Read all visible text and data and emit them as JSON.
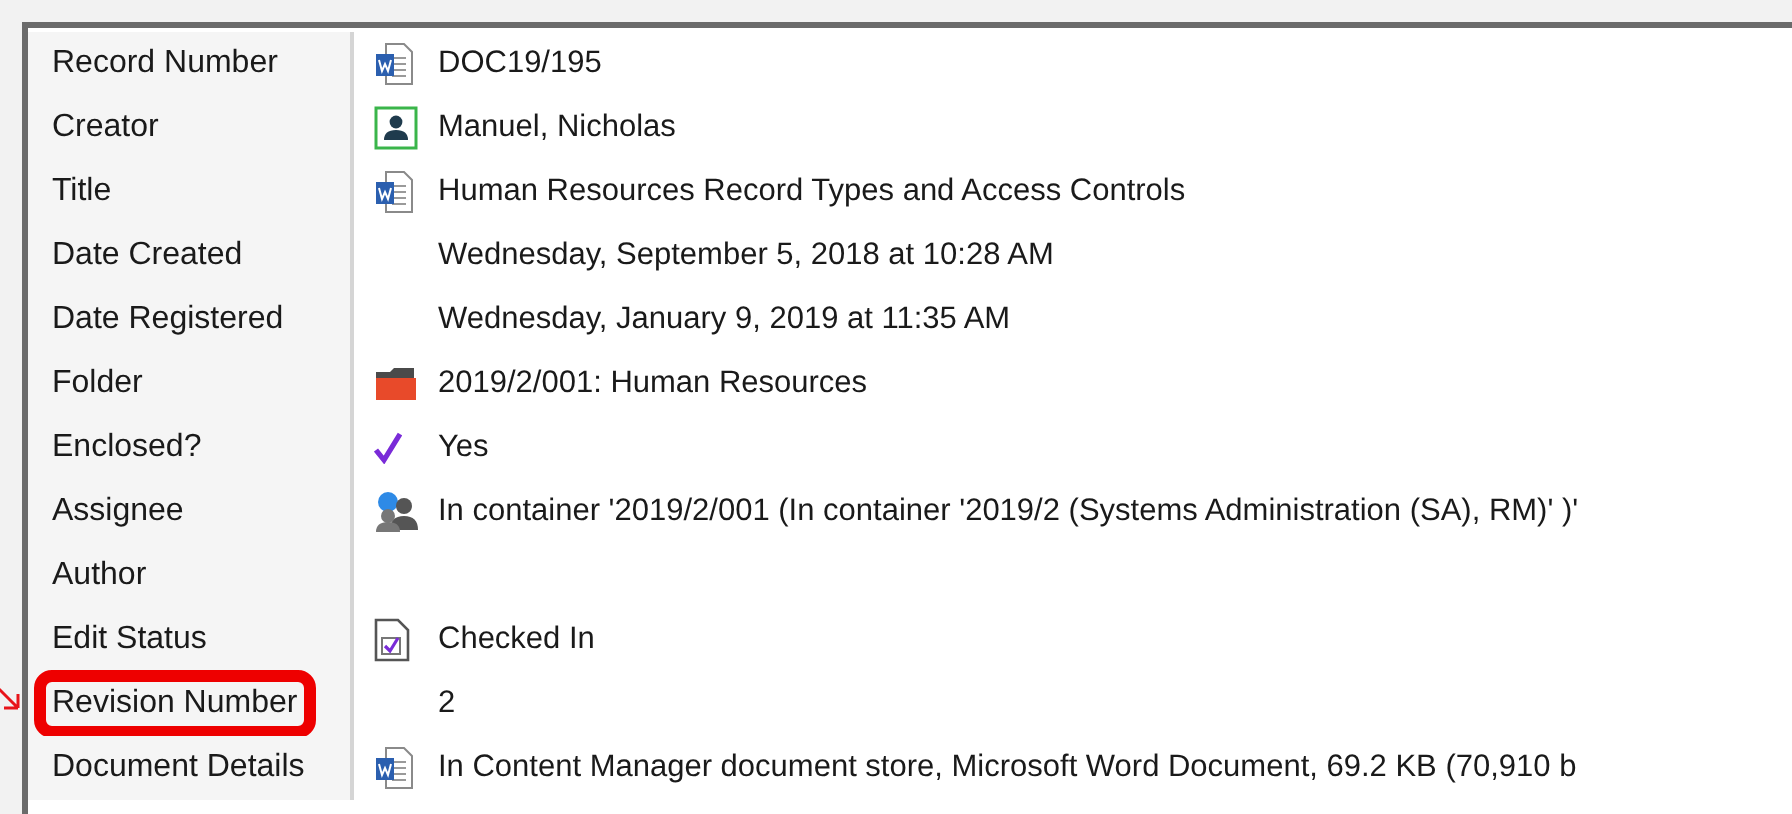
{
  "properties": [
    {
      "label": "Record Number",
      "value": "DOC19/195",
      "kind": "word",
      "highlighted": false
    },
    {
      "label": "Creator",
      "value": "Manuel, Nicholas",
      "kind": "person",
      "highlighted": false
    },
    {
      "label": "Title",
      "value": "Human Resources Record Types and Access Controls",
      "kind": "word",
      "highlighted": false
    },
    {
      "label": "Date Created",
      "value": "Wednesday, September 5, 2018 at 10:28 AM",
      "kind": "plain",
      "highlighted": false
    },
    {
      "label": "Date Registered",
      "value": "Wednesday, January 9, 2019 at 11:35 AM",
      "kind": "plain",
      "highlighted": false
    },
    {
      "label": "Folder",
      "value": "2019/2/001: Human Resources",
      "kind": "folder",
      "highlighted": false
    },
    {
      "label": "Enclosed?",
      "value": "Yes",
      "kind": "check",
      "highlighted": false
    },
    {
      "label": "Assignee",
      "value": "In container '2019/2/001 (In container '2019/2 (Systems Administration (SA), RM)' )'",
      "kind": "group",
      "highlighted": false
    },
    {
      "label": "Author",
      "kind": "plain",
      "highlighted": false
    },
    {
      "label": "Edit Status",
      "value": "Checked In",
      "kind": "status",
      "highlighted": false
    },
    {
      "label": "Revision Number",
      "value": "2",
      "kind": "plain",
      "highlighted": true
    },
    {
      "label": "Document Details",
      "value": "In Content Manager document store, Microsoft Word Document, 69.2 KB (70,910 b",
      "kind": "word",
      "highlighted": false
    }
  ]
}
